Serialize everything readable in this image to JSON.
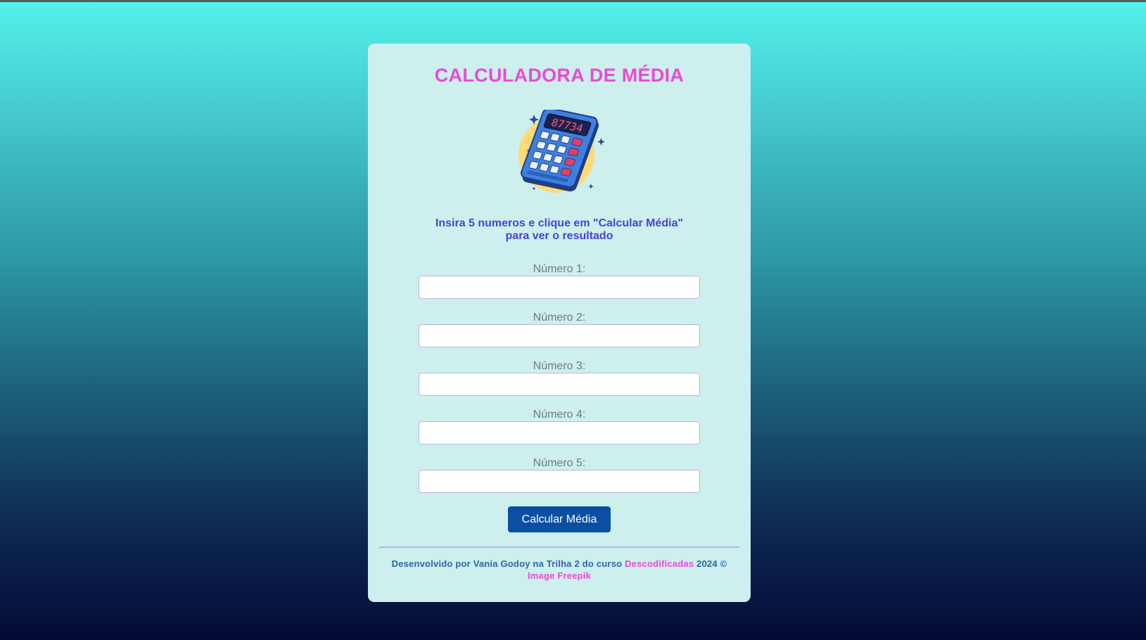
{
  "header": {
    "title": "CALCULADORA DE MÉDIA"
  },
  "image": {
    "icon": "calculator-illustration",
    "display_digits": "87734"
  },
  "instructions": {
    "line1": "Insira 5 numeros e clique em \"Calcular Média\"",
    "line2": "para ver o resultado"
  },
  "form": {
    "fields": [
      {
        "label": "Número 1:",
        "value": ""
      },
      {
        "label": "Número 2:",
        "value": ""
      },
      {
        "label": "Número 3:",
        "value": ""
      },
      {
        "label": "Número 4:",
        "value": ""
      },
      {
        "label": "Número 5:",
        "value": ""
      }
    ],
    "submit_label": "Calcular Média"
  },
  "footer": {
    "text_before": "Desenvolvido por Vania Godoy na Trilha 2 do curso ",
    "link_course": "Descodificadas",
    "text_after": " 2024 ©",
    "link_image": "Image Freepik"
  },
  "colors": {
    "title": "#e94ad9",
    "instructions": "#4a41d8",
    "button": "#0b4fa3",
    "card": "#cdefed",
    "footer_text": "#2b66a8",
    "link": "#e94ad9"
  }
}
